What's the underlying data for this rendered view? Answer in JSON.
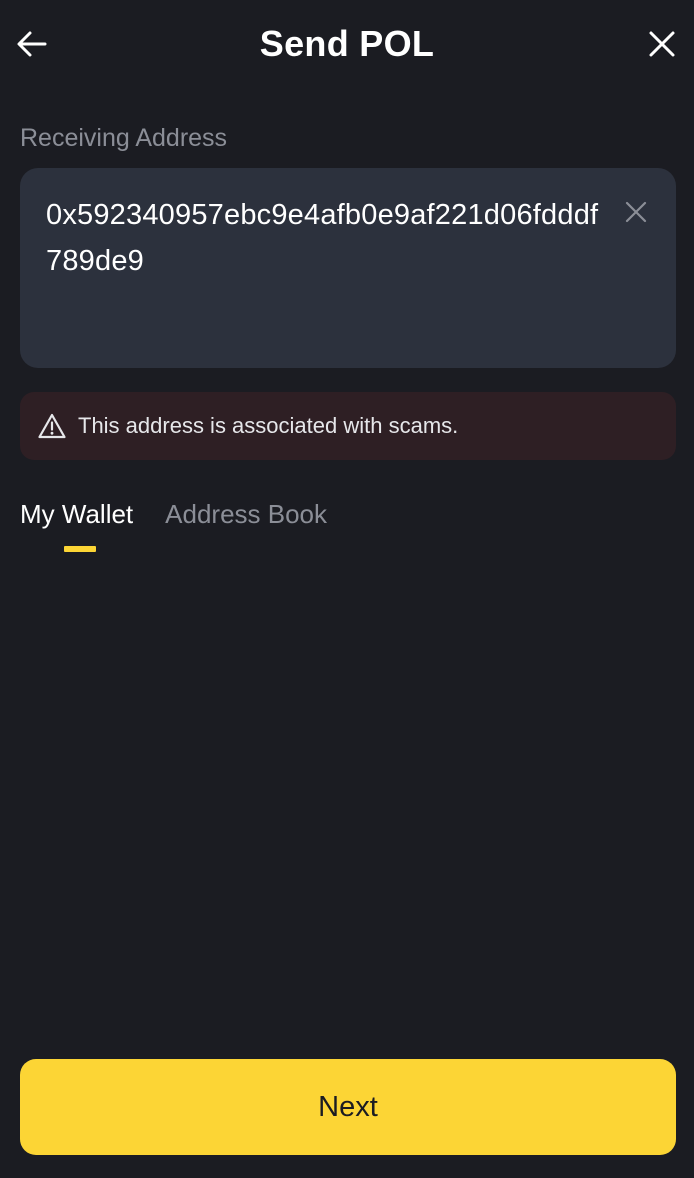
{
  "header": {
    "title": "Send POL",
    "back_icon": "arrow-left-icon",
    "close_icon": "close-icon"
  },
  "receiving": {
    "label": "Receiving Address",
    "address": "0x592340957ebc9e4afb0e9af221d06fdddf789de9",
    "clear_icon": "clear-icon"
  },
  "warning": {
    "icon": "warning-triangle-icon",
    "text": "This address is associated with scams."
  },
  "tabs": [
    {
      "label": "My Wallet",
      "active": true
    },
    {
      "label": "Address Book",
      "active": false
    }
  ],
  "footer": {
    "next_label": "Next"
  },
  "colors": {
    "background": "#1b1c22",
    "input_bg": "#2c313d",
    "warning_bg": "#2e1f24",
    "accent": "#fcd535",
    "muted_text": "#8b8e97"
  }
}
